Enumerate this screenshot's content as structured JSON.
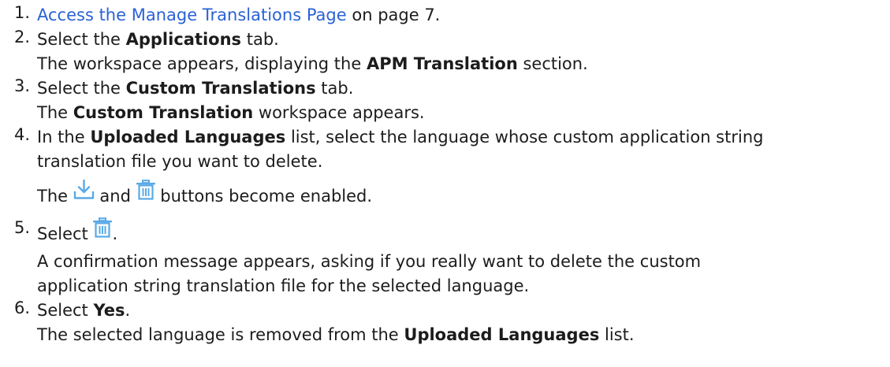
{
  "colors": {
    "link": "#2a62d6",
    "icon_blue": "#5aa9e6",
    "text": "#1c1c1c"
  },
  "icons": {
    "download": "download-icon",
    "delete": "trash-icon"
  },
  "steps": [
    {
      "num": "1.",
      "link": "Access the Manage Translations Page",
      "after_link": " on page 7."
    },
    {
      "num": "2.",
      "pre": "Select the ",
      "bold": "Applications",
      "post": " tab.",
      "result_pre": "The workspace appears, displaying the ",
      "result_bold": "APM Translation",
      "result_post": " section."
    },
    {
      "num": "3.",
      "pre": "Select the ",
      "bold": "Custom Translations",
      "post": " tab.",
      "result_pre": "The ",
      "result_bold": "Custom Translation",
      "result_post": " workspace appears."
    },
    {
      "num": "4.",
      "pre": "In the ",
      "bold": "Uploaded Languages",
      "post": " list, select the language whose custom application string",
      "line2": "translation file you want to delete.",
      "result_pre": "The ",
      "result_mid": " and ",
      "result_post": " buttons become enabled."
    },
    {
      "num": "5.",
      "pre": "Select ",
      "post": ".",
      "result_line1": "A confirmation message appears, asking if you really want to delete the custom",
      "result_line2": "application string translation file for the selected language."
    },
    {
      "num": "6.",
      "pre": "Select ",
      "bold": "Yes",
      "post": ".",
      "result_pre": "The selected language is removed from the ",
      "result_bold": "Uploaded Languages",
      "result_post": " list."
    }
  ]
}
